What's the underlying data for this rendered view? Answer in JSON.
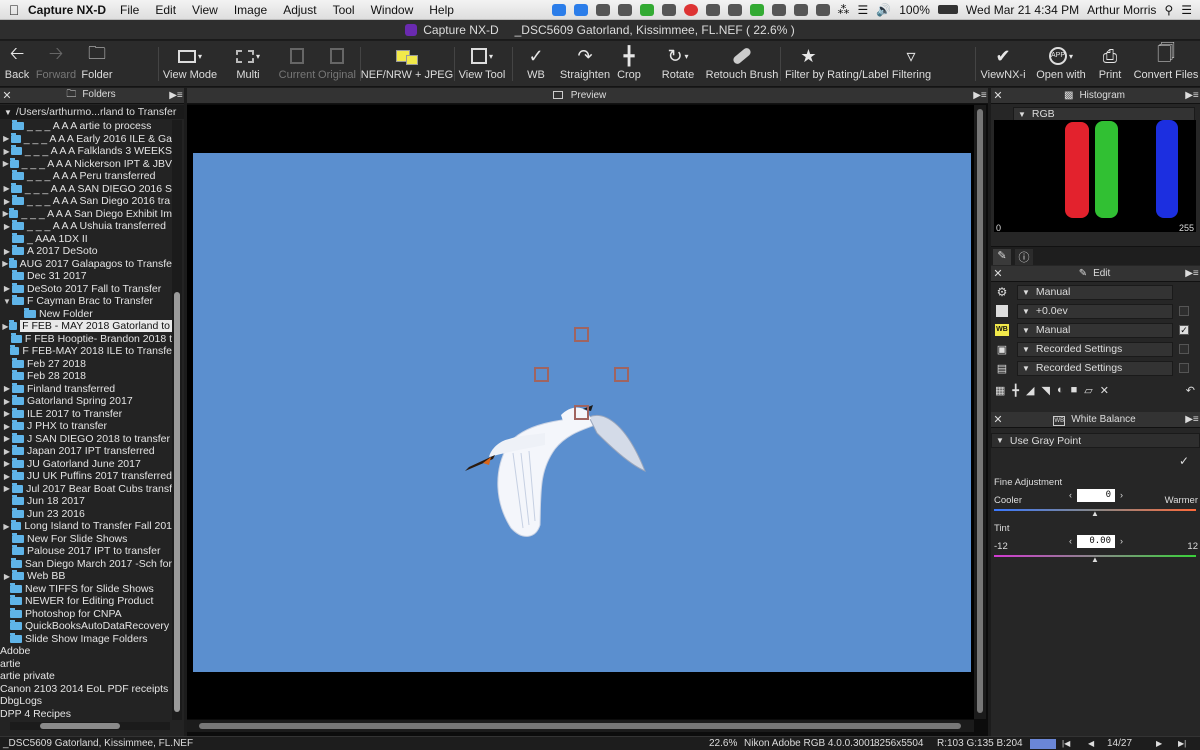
{
  "menubar": {
    "app": "Capture NX-D",
    "items": [
      "File",
      "Edit",
      "View",
      "Image",
      "Adjust",
      "Tool",
      "Window",
      "Help"
    ],
    "battery": "100%",
    "datetime": "Wed Mar 21  4:34 PM",
    "user": "Arthur Morris"
  },
  "titlebar": {
    "app": "Capture NX-D",
    "document": "_DSC5609  Gatorland, Kissimmee, FL.NEF ( 22.6% )"
  },
  "toolbar": {
    "back": "Back",
    "forward": "Forward",
    "folder": "Folder",
    "view_mode": "View Mode",
    "multi": "Multi",
    "current": "Current",
    "original": "Original",
    "nef_jpeg": "NEF/NRW + JPEG",
    "view_tool": "View Tool",
    "wb": "WB",
    "straighten": "Straighten",
    "crop": "Crop",
    "rotate": "Rotate",
    "retouch_brush": "Retouch Brush",
    "filter": "Filter by Rating/Label Filtering",
    "viewnxi": "ViewNX-i",
    "open_with": "Open with",
    "print": "Print",
    "convert_files": "Convert Files"
  },
  "folders_panel": {
    "title": "Folders",
    "path": "/Users/arthurmo...rland to Transfer",
    "items": [
      {
        "label": "_ _ _ A A A artie to process",
        "indent": 1,
        "tri": false
      },
      {
        "label": "_ _ _ A A A Early 2016 ILE & Ga",
        "indent": 1,
        "tri": true
      },
      {
        "label": "_ _ _ A A A Falklands 3 WEEKS",
        "indent": 1,
        "tri": true
      },
      {
        "label": "_ _ _ A A A Nickerson IPT & JBV",
        "indent": 1,
        "tri": true
      },
      {
        "label": "_ _ _ A A A Peru transferred",
        "indent": 1,
        "tri": false
      },
      {
        "label": "_ _ _ A A A SAN DIEGO 2016 S",
        "indent": 1,
        "tri": true
      },
      {
        "label": "_ _ _ A A A San Diego 2016 tra",
        "indent": 1,
        "tri": true
      },
      {
        "label": "_ _ _ A A A San Diego Exhibit Im",
        "indent": 1,
        "tri": true
      },
      {
        "label": "_ _ _ A A A Ushuia transferred",
        "indent": 1,
        "tri": true
      },
      {
        "label": "_ AAA 1DX II",
        "indent": 1,
        "tri": false
      },
      {
        "label": "A 2017 DeSoto",
        "indent": 1,
        "tri": true
      },
      {
        "label": "AUG 2017 Galapagos to Transfe",
        "indent": 1,
        "tri": true
      },
      {
        "label": "Dec 31 2017",
        "indent": 1,
        "tri": false
      },
      {
        "label": "DeSoto 2017 Fall to Transfer",
        "indent": 1,
        "tri": true
      },
      {
        "label": "F Cayman Brac to Transfer",
        "indent": 1,
        "tri": "open"
      },
      {
        "label": "New Folder",
        "indent": 2,
        "tri": false
      },
      {
        "label": "F FEB - MAY 2018 Gatorland to",
        "indent": 1,
        "tri": true,
        "selected": true
      },
      {
        "label": "F FEB Hooptie- Brandon 2018 t",
        "indent": 1,
        "tri": false
      },
      {
        "label": "F FEB-MAY 2018 ILE to Transfe",
        "indent": 1,
        "tri": false
      },
      {
        "label": "Feb 27 2018",
        "indent": 1,
        "tri": false
      },
      {
        "label": "Feb 28 2018",
        "indent": 1,
        "tri": false
      },
      {
        "label": "Finland transferred",
        "indent": 1,
        "tri": true
      },
      {
        "label": "Gatorland Spring 2017",
        "indent": 1,
        "tri": true
      },
      {
        "label": "ILE  2017 to Transfer",
        "indent": 1,
        "tri": true
      },
      {
        "label": "J PHX to transfer",
        "indent": 1,
        "tri": true
      },
      {
        "label": "J SAN DIEGO 2018 to transfer",
        "indent": 1,
        "tri": true
      },
      {
        "label": "Japan 2017 IPT transferred",
        "indent": 1,
        "tri": true
      },
      {
        "label": "JU Gatorland June 2017",
        "indent": 1,
        "tri": true
      },
      {
        "label": "JU UK Puffins 2017 transferred",
        "indent": 1,
        "tri": true
      },
      {
        "label": "Jul 2017 Bear Boat Cubs transf",
        "indent": 1,
        "tri": true
      },
      {
        "label": "Jun 18 2017",
        "indent": 1,
        "tri": false
      },
      {
        "label": "Jun 23 2016",
        "indent": 1,
        "tri": false
      },
      {
        "label": "Long Island to Transfer Fall 201",
        "indent": 1,
        "tri": true
      },
      {
        "label": "New For Slide Shows",
        "indent": 1,
        "tri": false
      },
      {
        "label": "Palouse 2017 IPT to transfer",
        "indent": 1,
        "tri": false
      },
      {
        "label": "San Diego March 2017 -Sch for",
        "indent": 1,
        "tri": false
      },
      {
        "label": "Web BB",
        "indent": 1,
        "tri": true
      },
      {
        "label": "New TIFFS for Slide Shows",
        "indent": 0,
        "tri": false
      },
      {
        "label": "NEWER for Editing Product",
        "indent": 0,
        "tri": false
      },
      {
        "label": "Photoshop for CNPA",
        "indent": 0,
        "tri": false
      },
      {
        "label": "QuickBooksAutoDataRecovery",
        "indent": 0,
        "tri": false
      },
      {
        "label": "Slide Show Image Folders",
        "indent": 0,
        "tri": false
      },
      {
        "label": "Adobe",
        "indent": -1,
        "tri": false
      },
      {
        "label": "artie",
        "indent": -1,
        "tri": false
      },
      {
        "label": "artie private",
        "indent": -1,
        "tri": false
      },
      {
        "label": "Canon 2103 2014 EoL PDF receipts",
        "indent": -1,
        "tri": false
      },
      {
        "label": "DbgLogs",
        "indent": -1,
        "tri": false
      },
      {
        "label": "DPP 4 Recipes",
        "indent": -1,
        "tri": false
      }
    ]
  },
  "preview_panel": {
    "title": "Preview"
  },
  "histogram_panel": {
    "title": "Histogram",
    "channel": "RGB",
    "axis_min": "0",
    "axis_max": "255",
    "colors": {
      "red": "#e3222d",
      "green": "#31c033",
      "blue": "#1c2fe0"
    }
  },
  "edit_panel": {
    "title": "Edit",
    "rows": [
      {
        "value": "Manual",
        "checked": null
      },
      {
        "value": "+0.0ev",
        "checked": false
      },
      {
        "value": "Manual",
        "checked": true
      },
      {
        "value": "Recorded Settings",
        "checked": false
      },
      {
        "value": "Recorded Settings",
        "checked": false
      }
    ]
  },
  "wb_panel": {
    "title": "White Balance",
    "mode": "Use Gray Point",
    "fine_adjustment_label": "Fine Adjustment",
    "cooler": "Cooler",
    "warmer": "Warmer",
    "fine_value": "0",
    "tint_label": "Tint",
    "tint_min": "-12",
    "tint_max": "12",
    "tint_value": "0.00"
  },
  "statusbar": {
    "filename": "_DSC5609  Gatorland, Kissimmee, FL.NEF",
    "zoom": "22.6%",
    "profile": "Nikon Adobe RGB 4.0.0.3001",
    "dimensions": "8256x5504",
    "rgb": "R:103 G:135 B:204",
    "sample_color": "#6a86d6",
    "position": "14/27"
  }
}
